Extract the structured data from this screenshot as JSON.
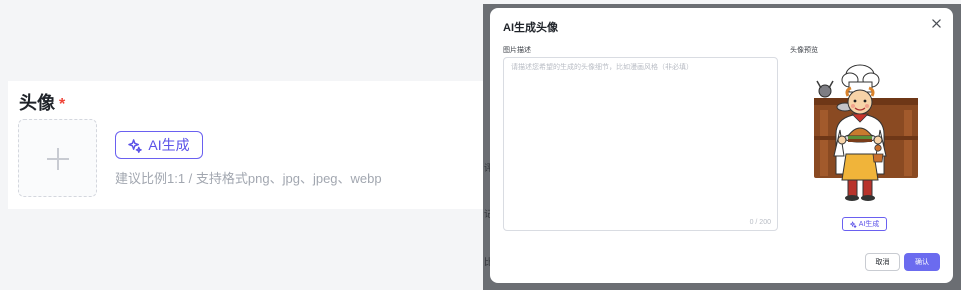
{
  "form": {
    "avatar_label": "头像",
    "required_mark": "*",
    "ai_button_label": "AI生成",
    "hint": "建议比例1:1 / 支持格式png、jpg、jpeg、webp"
  },
  "backdrop": {
    "fragments": [
      "评",
      "记",
      "比"
    ]
  },
  "modal": {
    "title": "AI生成头像",
    "description_label": "图片描述",
    "description_placeholder": "请描述您希望的生成的头像细节，比如漫画风格（非必填）",
    "description_value": "",
    "counter": "0 / 200",
    "preview_label": "头像预览",
    "ai_button_label": "AI生成",
    "cancel_label": "取消",
    "confirm_label": "确认"
  },
  "colors": {
    "accent": "#5b52e8",
    "confirm_bg": "#6b6bef",
    "required": "#f04438"
  },
  "icons": {
    "upload": "plus-icon",
    "ai": "sparkle-icon",
    "close": "close-icon"
  }
}
